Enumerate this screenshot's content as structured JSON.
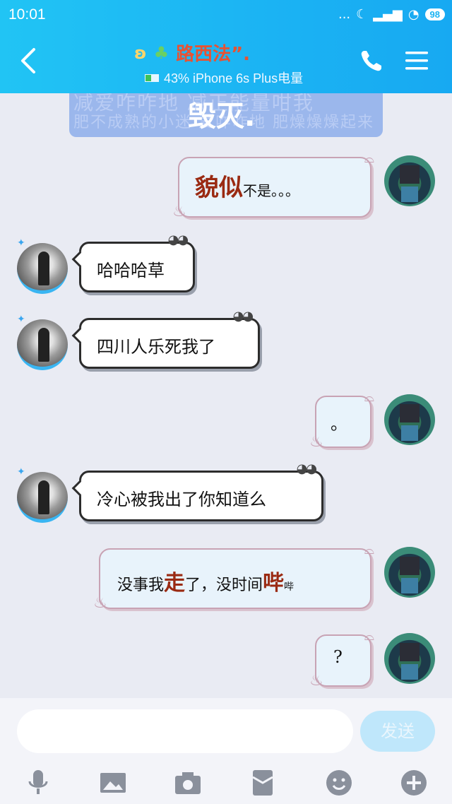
{
  "status": {
    "time": "10:01",
    "dots": "...",
    "battery": "98"
  },
  "header": {
    "name": "路西法”.",
    "subtitle": "43% iPhone 6s Plus电量"
  },
  "banner": {
    "bg_text": "减爱咋咋地 减正能量咁我",
    "bg_text2": "肥不成熟的小迷 爱咋咋地 肥燥燥燥起来",
    "big": "毁灭."
  },
  "messages": [
    {
      "side": "me",
      "text_big": "貌似",
      "text_small": "不是。。。"
    },
    {
      "side": "other",
      "text": "哈哈哈草"
    },
    {
      "side": "other",
      "text": "四川人乐死我了"
    },
    {
      "side": "me",
      "text": "。"
    },
    {
      "side": "other",
      "text": "冷心被我出了你知道么"
    },
    {
      "side": "me",
      "a": "没事我",
      "b": "走",
      "c": "了，没时间",
      "d": "哔",
      "e": "哔"
    },
    {
      "side": "me",
      "text": "?"
    }
  ],
  "input": {
    "placeholder": "",
    "send": "发送"
  },
  "icons": [
    "mic-icon",
    "image-icon",
    "camera-icon",
    "red-packet-icon",
    "emoji-icon",
    "plus-icon"
  ]
}
